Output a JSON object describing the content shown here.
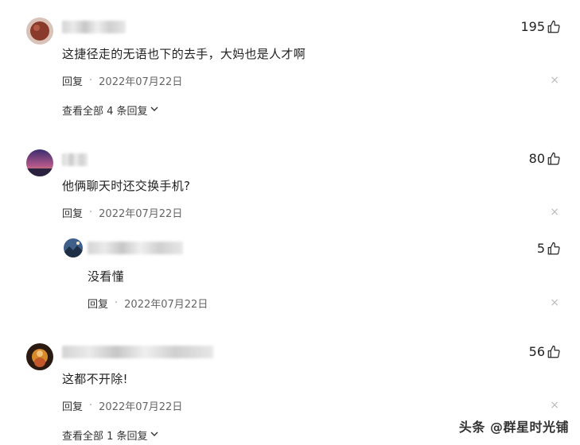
{
  "comments": [
    {
      "likes": "195",
      "content": "这捷径走的无语也下的去手，大妈也是人才啊",
      "reply_label": "回复",
      "separator": "·",
      "date": "2022年07月22日",
      "expand_text": "查看全部 4 条回复"
    },
    {
      "likes": "80",
      "content": "他俩聊天时还交换手机?",
      "reply_label": "回复",
      "separator": "·",
      "date": "2022年07月22日"
    },
    {
      "likes": "5",
      "content": "没看懂",
      "reply_label": "回复",
      "separator": "·",
      "date": "2022年07月22日"
    },
    {
      "likes": "56",
      "content": "这都不开除!",
      "reply_label": "回复",
      "separator": "·",
      "date": "2022年07月22日",
      "expand_text": "查看全部 1 条回复"
    }
  ],
  "close_glyph": "×",
  "watermark": "头条 @群星时光铺",
  "colors": {
    "text": "#222222",
    "meta": "#666666",
    "close": "#bbbbbb"
  }
}
